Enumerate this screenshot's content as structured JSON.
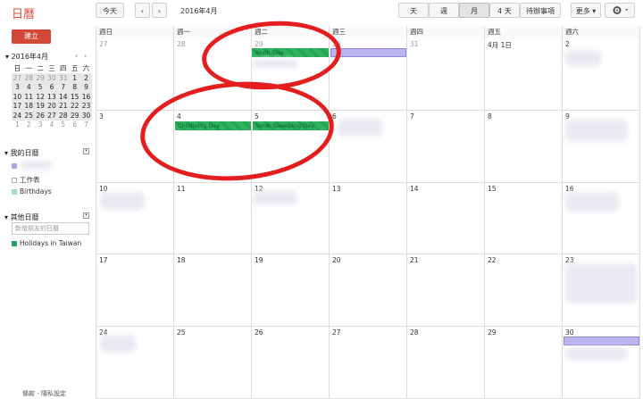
{
  "header": {
    "app_title": "日曆",
    "today_label": "今天",
    "prev_icon": "chevron-left",
    "next_icon": "chevron-right",
    "date_range": "2016年4月",
    "views": [
      "天",
      "週",
      "月",
      "4 天",
      "待辦事項"
    ],
    "active_view": "月",
    "more_label": "更多 ▾",
    "settings_icon": "gear"
  },
  "sidebar": {
    "create_label": "建立",
    "mini_title": "2016年4月",
    "mini_weekdays": [
      "日",
      "一",
      "二",
      "三",
      "四",
      "五",
      "六"
    ],
    "mini_weeks": [
      [
        "27",
        "28",
        "29",
        "30",
        "31",
        "1",
        "2"
      ],
      [
        "3",
        "4",
        "5",
        "6",
        "7",
        "8",
        "9"
      ],
      [
        "10",
        "11",
        "12",
        "13",
        "14",
        "15",
        "16"
      ],
      [
        "17",
        "18",
        "19",
        "20",
        "21",
        "22",
        "23"
      ],
      [
        "24",
        "25",
        "26",
        "27",
        "28",
        "29",
        "30"
      ],
      [
        "1",
        "2",
        "3",
        "4",
        "5",
        "6",
        "7"
      ]
    ],
    "my_calendars_label": "我的日曆",
    "my_calendars": [
      {
        "label": "",
        "color": "#a9a4e8"
      },
      {
        "label": "工作表",
        "color": "#ffffff"
      },
      {
        "label": "Birthdays",
        "color": "#9fe1bf"
      }
    ],
    "other_calendars_label": "其他日曆",
    "add_friend_placeholder": "新增朋友的日曆",
    "other_calendars": [
      {
        "label": "Holidays in Taiwan",
        "color": "#1ea35e"
      }
    ],
    "footer_links": "條款 - 隱私設定"
  },
  "calendar": {
    "weekday_headers": [
      "週日",
      "週一",
      "週二",
      "週三",
      "週四",
      "週五",
      "週六"
    ],
    "weeks": [
      [
        "27",
        "28",
        "29",
        "30",
        "31",
        "4月 1日",
        "2"
      ],
      [
        "3",
        "4",
        "5",
        "6",
        "7",
        "8",
        "9"
      ],
      [
        "10",
        "11",
        "12",
        "13",
        "14",
        "15",
        "16"
      ],
      [
        "17",
        "18",
        "19",
        "20",
        "21",
        "22",
        "23"
      ],
      [
        "24",
        "25",
        "26",
        "27",
        "28",
        "29",
        "30"
      ]
    ],
    "events": [
      {
        "title": "Youth Day",
        "style": "green"
      },
      {
        "title": "",
        "style": "purple"
      },
      {
        "title": "Children's Day",
        "style": "green"
      },
      {
        "title": "Tomb Sweeping Day",
        "style": "green"
      },
      {
        "title": "",
        "style": "purple"
      }
    ]
  }
}
